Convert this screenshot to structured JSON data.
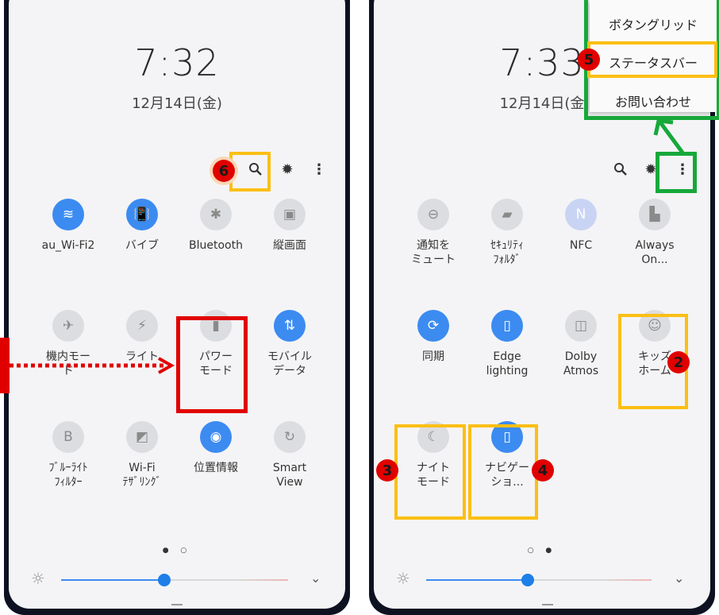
{
  "left": {
    "time": "7:32",
    "date": "12月14日(金)",
    "toolbar": {
      "search_icon": "search-icon",
      "settings_icon": "gear-icon",
      "more_icon": "more-vert-icon"
    },
    "tiles": [
      {
        "label": "au_Wi-Fi2",
        "icon": "wifi-icon",
        "state": "on",
        "glyph": "≋"
      },
      {
        "label": "バイブ",
        "icon": "vibrate-icon",
        "state": "on",
        "glyph": "📳"
      },
      {
        "label": "Bluetooth",
        "icon": "bluetooth-icon",
        "state": "off",
        "glyph": "✱"
      },
      {
        "label": "縦画面",
        "icon": "portrait-lock-icon",
        "state": "off",
        "glyph": "▣"
      },
      {
        "label": "機内モー\nド",
        "icon": "airplane-icon",
        "state": "off",
        "glyph": "✈"
      },
      {
        "label": "ライト",
        "icon": "flashlight-icon",
        "state": "off",
        "glyph": "⚡"
      },
      {
        "label": "パワー\nモード",
        "icon": "battery-icon",
        "state": "off",
        "glyph": "▮"
      },
      {
        "label": "モバイル\nデータ",
        "icon": "mobile-data-icon",
        "state": "on",
        "glyph": "⇅"
      },
      {
        "label": "ﾌﾞﾙｰﾗｲﾄ\nﾌｨﾙﾀｰ",
        "icon": "blue-light-icon",
        "state": "off",
        "glyph": "B"
      },
      {
        "label": "Wi-Fi\nﾃｻﾞﾘﾝｸﾞ",
        "icon": "hotspot-icon",
        "state": "off",
        "glyph": "◩"
      },
      {
        "label": "位置情報",
        "icon": "location-icon",
        "state": "on",
        "glyph": "◉"
      },
      {
        "label": "Smart\nView",
        "icon": "smart-view-icon",
        "state": "off",
        "glyph": "↻"
      }
    ],
    "page_dots": "● ○"
  },
  "right": {
    "time": "7:33",
    "date": "12月14日(金",
    "toolbar": {
      "search_icon": "search-icon",
      "settings_icon": "gear-icon",
      "more_icon": "more-vert-icon"
    },
    "tiles": [
      {
        "label": "通知を\nミュート",
        "icon": "mute-icon",
        "state": "off",
        "glyph": "⊖"
      },
      {
        "label": "ｾｷｭﾘﾃｨ\nﾌｫﾙﾀﾞ",
        "icon": "secure-folder-icon",
        "state": "off",
        "glyph": "▰"
      },
      {
        "label": "NFC",
        "icon": "nfc-icon",
        "state": "nfc",
        "glyph": "N"
      },
      {
        "label": "Always\nOn...",
        "icon": "always-on-icon",
        "state": "off",
        "glyph": "▙"
      },
      {
        "label": "同期",
        "icon": "sync-icon",
        "state": "on",
        "glyph": "⟳"
      },
      {
        "label": "Edge\nlighting",
        "icon": "edge-lighting-icon",
        "state": "on",
        "glyph": "▯"
      },
      {
        "label": "Dolby\nAtmos",
        "icon": "dolby-icon",
        "state": "off",
        "glyph": "◫"
      },
      {
        "label": "キッズ\nホーム",
        "icon": "kids-home-icon",
        "state": "off",
        "glyph": "☺"
      },
      {
        "label": "ナイト\nモード",
        "icon": "night-mode-icon",
        "state": "off",
        "glyph": "☾"
      },
      {
        "label": "ナビゲー\nショ...",
        "icon": "navigation-bar-icon",
        "state": "on",
        "glyph": "▯"
      }
    ],
    "page_dots": "○ ●"
  },
  "menu": {
    "items": [
      "ボタングリッド",
      "ステータスバー",
      "お問い合わせ"
    ]
  },
  "badges": {
    "b2": "2",
    "b3": "3",
    "b4": "4",
    "b5": "5",
    "b6": "6"
  },
  "colors": {
    "accent": "#3c8bf1",
    "highlight_yellow": "#fbbf14",
    "highlight_red": "#e10000",
    "highlight_green": "#17a83a"
  },
  "brightness": {
    "left_level": 0.45,
    "right_level": 0.45
  }
}
